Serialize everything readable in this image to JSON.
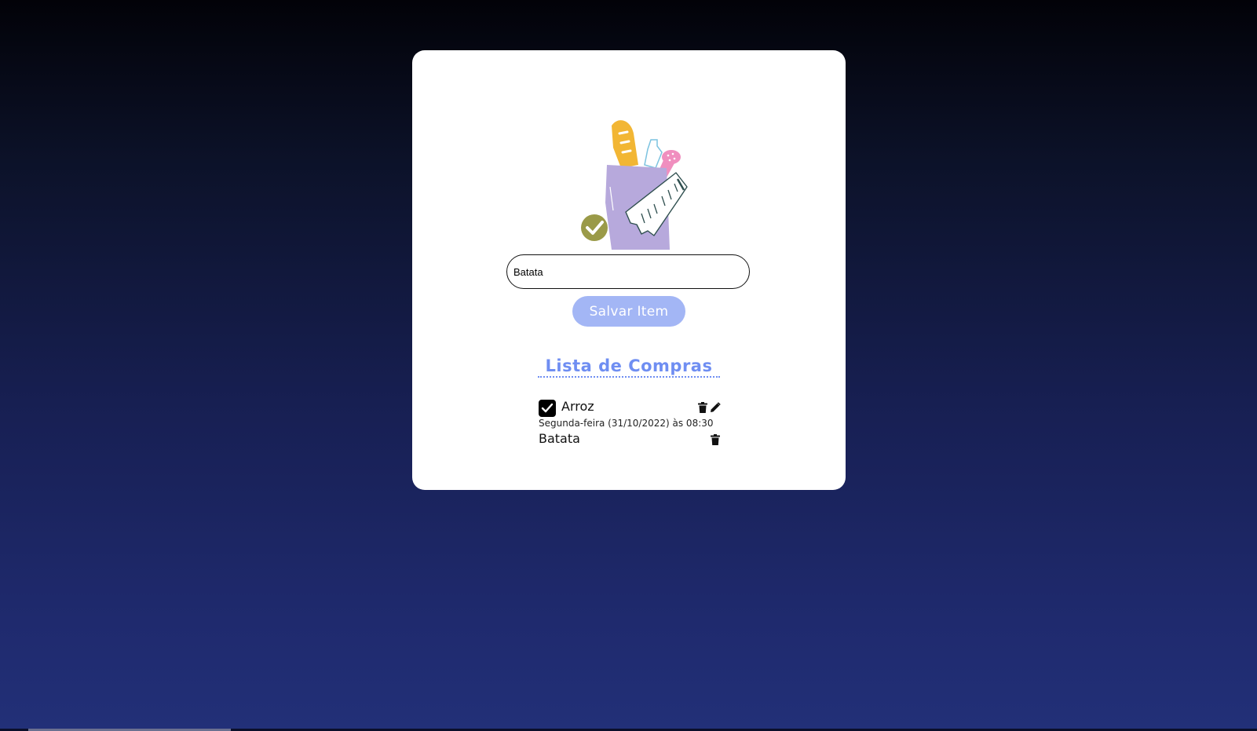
{
  "form": {
    "input_value": "Batata",
    "save_label": "Salvar Item"
  },
  "list": {
    "title": "Lista de Compras",
    "items": [
      {
        "name": "Arroz",
        "checked": true,
        "date": "Segunda-feira (31/10/2022) às 08:30",
        "actions": [
          "trash-icon",
          "pencil-icon"
        ]
      },
      {
        "name": "Batata",
        "checked": false,
        "actions": [
          "trash-icon"
        ]
      }
    ]
  },
  "colors": {
    "accent": "#6f8ef2",
    "button": "#a3b6f5",
    "bag": "#b7a9dc",
    "bread": "#f2b634",
    "check_badge": "#9a9a48"
  }
}
